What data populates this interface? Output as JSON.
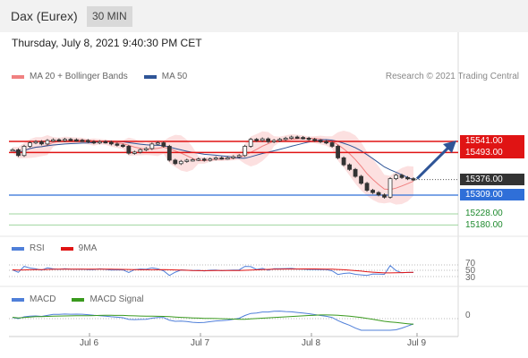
{
  "header": {
    "title": "Dax (Eurex)",
    "period": "30 MIN"
  },
  "timestamp": "Thursday, July 8, 2021 9:40:30 PM CET",
  "legend_main": [
    {
      "label": "MA 20 + Bollinger Bands",
      "color": "#f08080"
    },
    {
      "label": "MA 50",
      "color": "#2f5597"
    }
  ],
  "credit": "Research © 2021 Trading Central",
  "price_labels": {
    "resistance_2": "15541.00",
    "resistance_1": "15493.00",
    "last_price": "15376.00",
    "support_1": "15309.00",
    "support_2": "15228.00",
    "support_3": "15180.00"
  },
  "legend_rsi": [
    {
      "label": "RSI",
      "color": "#4f7fd9"
    },
    {
      "label": "9MA",
      "color": "#e01414"
    }
  ],
  "rsi_ticks": [
    "70",
    "50",
    "30"
  ],
  "legend_macd": [
    {
      "label": "MACD",
      "color": "#4f7fd9"
    },
    {
      "label": "MACD Signal",
      "color": "#3a9a1e"
    }
  ],
  "macd_tick": "0",
  "x_axis_labels": [
    "Jul 6",
    "Jul 7",
    "Jul 8",
    "Jul 9"
  ],
  "colors": {
    "resistance": "#e01414",
    "support": "#2f6fd8",
    "support_green": "#1e8a2e",
    "bollinger_fill": "#fbdada",
    "candle": "#333333",
    "arrow": "#2f5597"
  },
  "chart_data": {
    "type": "line",
    "price_series": [
      15505,
      15480,
      15520,
      15535,
      15540,
      15530,
      15545,
      15548,
      15545,
      15550,
      15548,
      15546,
      15545,
      15540,
      15535,
      15540,
      15538,
      15530,
      15525,
      15520,
      15490,
      15495,
      15505,
      15510,
      15530,
      15535,
      15520,
      15460,
      15445,
      15455,
      15460,
      15462,
      15465,
      15460,
      15465,
      15470,
      15468,
      15470,
      15475,
      15480,
      15520,
      15550,
      15545,
      15552,
      15540,
      15545,
      15550,
      15555,
      15560,
      15558,
      15555,
      15550,
      15545,
      15540,
      15535,
      15520,
      15470,
      15440,
      15420,
      15390,
      15360,
      15330,
      15320,
      15310,
      15300,
      15380,
      15395,
      15385,
      15380,
      15376
    ],
    "levels": {
      "resistance": [
        15541,
        15493
      ],
      "last": 15376,
      "support": [
        15309,
        15228,
        15180
      ]
    },
    "rsi": {
      "levels": [
        70,
        50,
        30
      ]
    },
    "x_labels": [
      "Jul 6",
      "Jul 7",
      "Jul 8",
      "Jul 9"
    ]
  }
}
